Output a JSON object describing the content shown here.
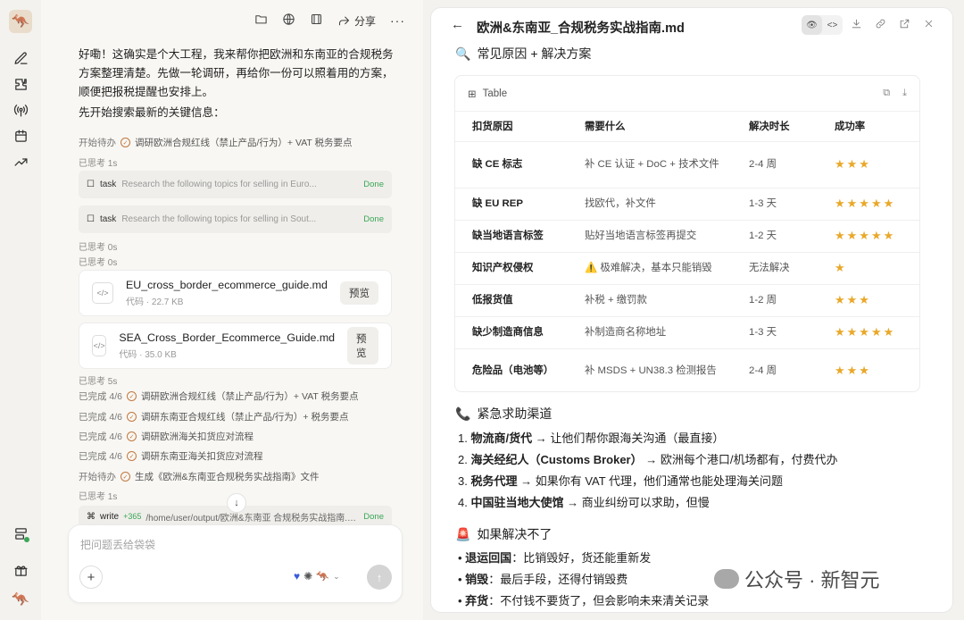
{
  "sidebar": {
    "icons": [
      "app-logo",
      "new-chat-icon",
      "plugin-icon",
      "broadcast-icon",
      "calendar-icon",
      "trending-icon",
      "server-icon",
      "gift-icon",
      "avatar"
    ]
  },
  "chat": {
    "toolbar": {
      "share_label": "分享"
    },
    "intro": "好嘞！这确实是个大工程，我来帮你把欧洲和东南亚的合规税务方案整理清楚。先做一轮调研，再给你一份可以照着用的方案，顺便把报税提醒也安排上。",
    "search_line": "先开始搜索最新的关键信息：",
    "steps": [
      {
        "status": "开始待办",
        "text": "调研欧洲合规红线（禁止产品/行为）+ VAT 税务要点"
      }
    ],
    "think1": "已思考 1s",
    "tasks": [
      {
        "kw": "task",
        "desc": "Research the following topics for selling in Euro...",
        "status": "Done"
      },
      {
        "kw": "task",
        "desc": "Research the following topics for selling in Sout...",
        "status": "Done"
      }
    ],
    "think2": "已思考 0s",
    "think3": "已思考 0s",
    "files": [
      {
        "name": "EU_cross_border_ecommerce_guide.md",
        "meta": "代码 · 22.7 KB",
        "button": "预览"
      },
      {
        "name": "SEA_Cross_Border_Ecommerce_Guide.md",
        "meta": "代码 · 35.0 KB",
        "button": "预览"
      }
    ],
    "think4": "已思考 5s",
    "done_steps": [
      {
        "status": "已完成 4/6",
        "text": "调研欧洲合规红线（禁止产品/行为）+ VAT 税务要点"
      },
      {
        "status": "已完成 4/6",
        "text": "调研东南亚合规红线（禁止产品/行为）+ 税务要点"
      },
      {
        "status": "已完成 4/6",
        "text": "调研欧洲海关扣货应对流程"
      },
      {
        "status": "已完成 4/6",
        "text": "调研东南亚海关扣货应对流程"
      },
      {
        "status": "开始待办",
        "text": "生成《欧洲&东南亚合规税务实战指南》文件"
      }
    ],
    "think5": "已思考 1s",
    "write": {
      "kw": "write",
      "added": "+365",
      "path": "/home/user/output/欧洲&东南亚 合规税务实战指南.md",
      "status": "Done"
    },
    "composer": {
      "placeholder": "把问题丢给袋袋"
    }
  },
  "doc": {
    "title": "欧洲&东南亚_合规税务实战指南.md",
    "section1": "常见原因 + 解决方案",
    "table_label": "Table",
    "headers": [
      "扣货原因",
      "需要什么",
      "解决时长",
      "成功率"
    ],
    "rows": [
      {
        "reason": "缺 CE 标志",
        "need": "补 CE 认证 + DoC + 技术文件",
        "time": "2-4 周",
        "rate": 3
      },
      {
        "reason": "缺 EU REP",
        "need": "找欧代，补文件",
        "time": "1-3 天",
        "rate": 5
      },
      {
        "reason": "缺当地语言标签",
        "need": "贴好当地语言标签再提交",
        "time": "1-2 天",
        "rate": 5
      },
      {
        "reason": "知识产权侵权",
        "need": "⚠️ 极难解决，基本只能销毁",
        "time": "无法解决",
        "rate": 1
      },
      {
        "reason": "低报货值",
        "need": "补税 + 缴罚款",
        "time": "1-2 周",
        "rate": 3
      },
      {
        "reason": "缺少制造商信息",
        "need": "补制造商名称地址",
        "time": "1-3 天",
        "rate": 5
      },
      {
        "reason": "危险品（电池等）",
        "need": "补 MSDS + UN38.3 检测报告",
        "time": "2-4 周",
        "rate": 3
      }
    ],
    "section2": "紧急求助渠道",
    "channels": [
      {
        "num": "1.",
        "name": "物流商/货代",
        "text": " → 让他们帮你跟海关沟通（最直接）"
      },
      {
        "num": "2.",
        "name": "海关经纪人（Customs Broker）",
        "text": " → 欧洲每个港口/机场都有，付费代办"
      },
      {
        "num": "3.",
        "name": "税务代理",
        "text": " → 如果你有 VAT 代理，他们通常也能处理海关问题"
      },
      {
        "num": "4.",
        "name": "中国驻当地大使馆",
        "text": " → 商业纠纷可以求助，但慢"
      }
    ],
    "section3": "如果解决不了",
    "fallbacks": [
      {
        "name": "退运回国",
        "text": "：比销毁好，货还能重新发"
      },
      {
        "name": "销毁",
        "text": "：最后手段，还得付销毁费"
      },
      {
        "name": "弃货",
        "text": "：不付钱不要货了，但会影响未来清关记录"
      }
    ]
  },
  "watermark": {
    "text": "公众号 · 新智元"
  }
}
